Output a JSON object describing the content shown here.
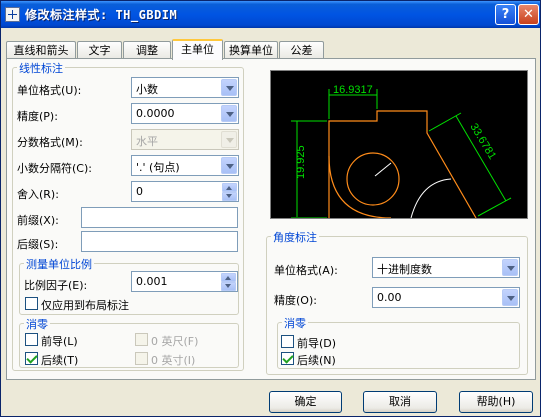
{
  "window": {
    "title": "修改标注样式: TH_GBDIM",
    "help_button": "?",
    "close_button": "✕"
  },
  "tabs": [
    {
      "label": "直线和箭头",
      "active": false
    },
    {
      "label": "文字",
      "active": false
    },
    {
      "label": "调整",
      "active": false
    },
    {
      "label": "主单位",
      "active": true
    },
    {
      "label": "换算单位",
      "active": false
    },
    {
      "label": "公差",
      "active": false
    }
  ],
  "linear": {
    "legend": "线性标注",
    "unit_format": {
      "label": "单位格式(U):",
      "value": "小数"
    },
    "precision": {
      "label": "精度(P):",
      "value": "0.0000"
    },
    "fraction_format": {
      "label": "分数格式(M):",
      "value": "水平",
      "disabled": true
    },
    "decimal_separator": {
      "label": "小数分隔符(C):",
      "value": "'.' (句点)"
    },
    "round_off": {
      "label": "舍入(R):",
      "value": "0"
    },
    "prefix": {
      "label": "前缀(X):",
      "value": ""
    },
    "suffix": {
      "label": "后缀(S):",
      "value": ""
    },
    "scale": {
      "legend": "测量单位比例",
      "factor_label": "比例因子(E):",
      "factor_value": "0.001",
      "layout_only_label": "仅应用到布局标注",
      "layout_only_checked": false
    },
    "zero_suppression": {
      "legend": "消零",
      "leading": {
        "label": "前导(L)",
        "checked": false
      },
      "trailing": {
        "label": "后续(T)",
        "checked": true
      },
      "feet": {
        "label": "0 英尺(F)",
        "checked": false,
        "disabled": true
      },
      "inches": {
        "label": "0 英寸(I)",
        "checked": false,
        "disabled": true
      }
    }
  },
  "preview": {
    "dim_horizontal": "16.9317",
    "dim_vertical": "19.925",
    "dim_aligned": "33.6781"
  },
  "angular": {
    "legend": "角度标注",
    "unit_format": {
      "label": "单位格式(A):",
      "value": "十进制度数"
    },
    "precision": {
      "label": "精度(O):",
      "value": "0.00"
    },
    "zero_suppression": {
      "legend": "消零",
      "leading": {
        "label": "前导(D)",
        "checked": false
      },
      "trailing": {
        "label": "后续(N)",
        "checked": true
      }
    }
  },
  "buttons": {
    "ok": "确定",
    "cancel": "取消",
    "help": "帮助(H)"
  },
  "colors": {
    "title_bar": "#0054e3",
    "group_legend": "#0046d5",
    "preview_bg": "#000000",
    "geometry": "#ff8c1a",
    "dimension": "#00e000",
    "center": "#ffffff"
  }
}
